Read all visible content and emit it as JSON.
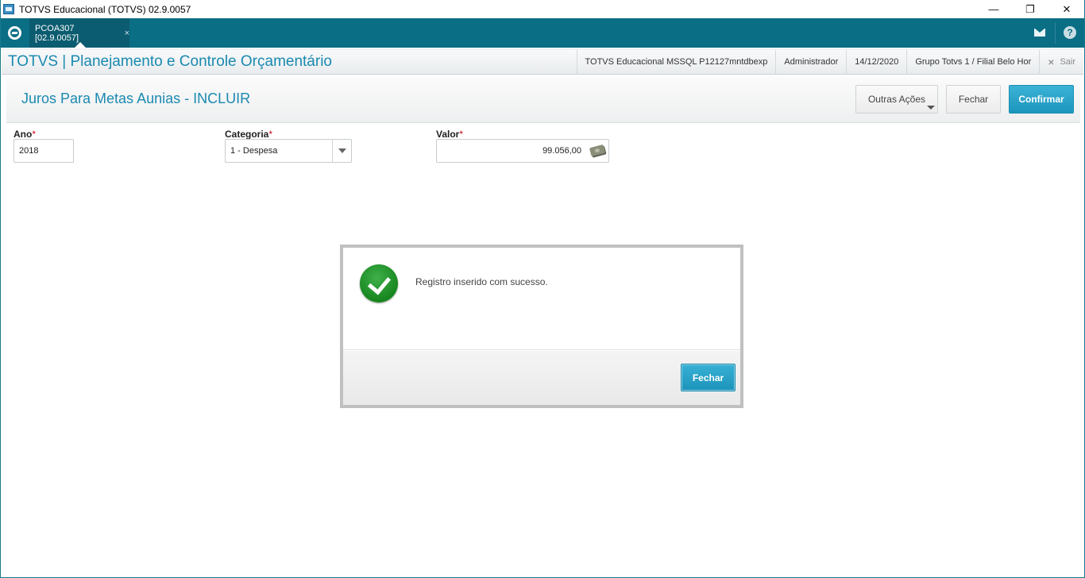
{
  "window": {
    "title": "TOTVS Educacional (TOTVS) 02.9.0057",
    "minimize": "—",
    "restore": "❐",
    "close": "✕"
  },
  "tabs": [
    {
      "label": "PCOA307 [02.9.0057]",
      "close": "×",
      "active": true
    }
  ],
  "topbar_icons": {
    "mail": "mail-icon",
    "help": "?"
  },
  "header": {
    "app_title": "TOTVS | Planejamento e Controle Orçamentário",
    "environment": "TOTVS Educacional MSSQL P12127mntdbexp",
    "user": "Administrador",
    "date": "14/12/2020",
    "branch": "Grupo Totvs 1 / Filial Belo Hor",
    "exit_label": "Sair",
    "exit_icon": "×"
  },
  "form": {
    "title": "Juros Para Metas Aunias - INCLUIR",
    "buttons": {
      "other_actions": "Outras Ações",
      "close": "Fechar",
      "confirm": "Confirmar"
    },
    "fields": {
      "ano": {
        "label": "Ano",
        "required": "*",
        "value": "2018"
      },
      "categoria": {
        "label": "Categoria",
        "required": "*",
        "value": "1 - Despesa"
      },
      "valor": {
        "label": "Valor",
        "required": "*",
        "value": "99.056,00"
      }
    }
  },
  "dialog": {
    "message": "Registro inserido com sucesso.",
    "button": "Fechar",
    "icon": "success-check-icon"
  },
  "colors": {
    "brand": "#0a6e85",
    "accent": "#1a8ab0",
    "primary_button": "#1d96bd",
    "success": "#17861f",
    "required": "#d0021b"
  }
}
